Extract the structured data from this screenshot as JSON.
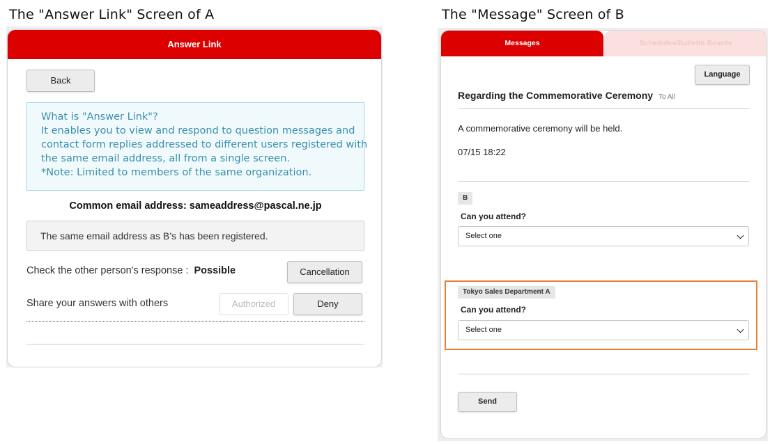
{
  "captions": {
    "left": "The \"Answer Link\" Screen of A",
    "right": "The \"Message\" Screen of B"
  },
  "colors": {
    "brand_red": "#dc0000",
    "highlight_orange": "#ed7d31",
    "info_blue": "#3c8ea9"
  },
  "screen_a": {
    "header_title": "Answer Link",
    "back_label": "Back",
    "info_lines": [
      "What is \"Answer Link\"?",
      "It enables you to view and respond to question messages and",
      "contact form replies addressed to different users registered with",
      "the same email address, all from a single screen.",
      "*Note: Limited to members of the same organization."
    ],
    "common_email": "Common email address: sameaddress@pascal.ne.jp",
    "same_address_notice": "The same email address as B’s has been registered.",
    "check_response_label": "Check the other person's response :",
    "check_response_value": "Possible",
    "cancellation_label": "Cancellation",
    "share_label": "Share your answers with others",
    "authorized_label": "Authorized",
    "deny_label": "Deny"
  },
  "screen_b": {
    "tabs": [
      "Messages",
      "Schedules/Bulletin Boards"
    ],
    "language_label": "Language",
    "message_title": "Regarding the Commemorative Ceremony",
    "to_label": "To All",
    "message_body": "A commemorative ceremony will be held.",
    "timestamp": "07/15 18:22",
    "questions": [
      {
        "tag": "B",
        "question": "Can you attend?",
        "selected": "Select one"
      },
      {
        "tag": "Tokyo Sales Department A",
        "question": "Can you attend?",
        "selected": "Select one"
      }
    ],
    "send_label": "Send"
  }
}
